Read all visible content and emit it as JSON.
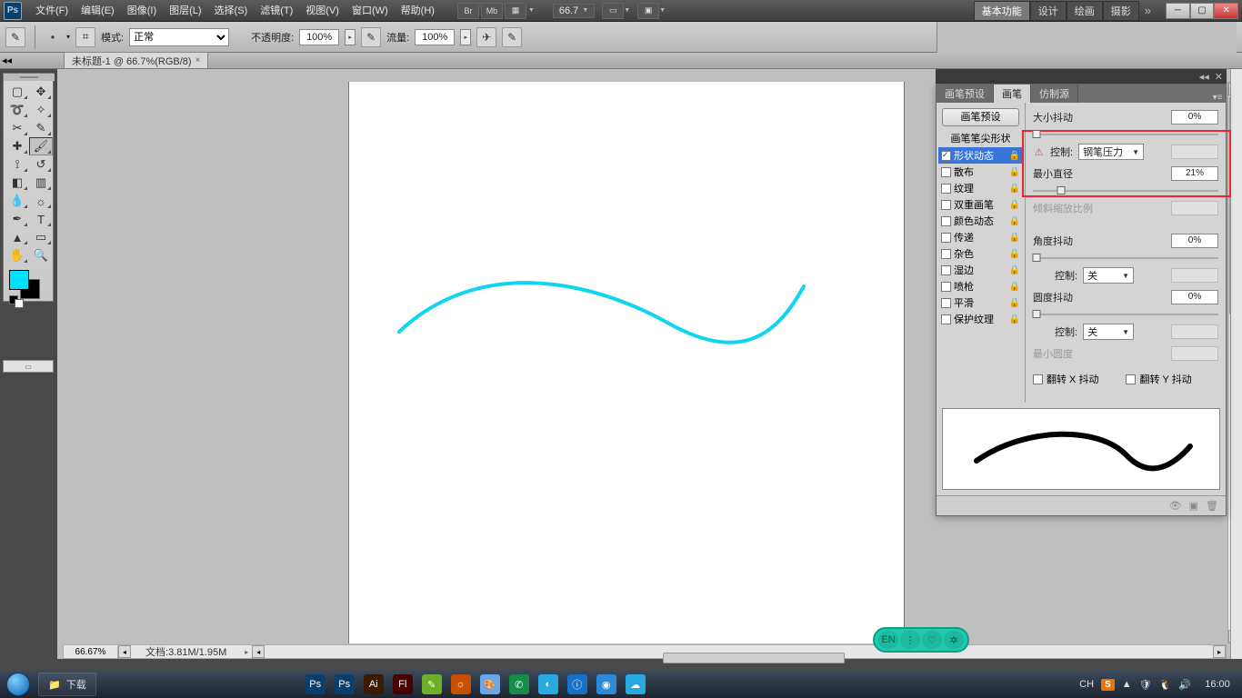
{
  "app": {
    "logo": "Ps"
  },
  "menu": [
    "文件(F)",
    "编辑(E)",
    "图像(I)",
    "图层(L)",
    "选择(S)",
    "滤镜(T)",
    "视图(V)",
    "窗口(W)",
    "帮助(H)"
  ],
  "menubar_icons": [
    "Br",
    "Mb",
    "▦"
  ],
  "menubar_zoom": "66.7",
  "workspaces": {
    "items": [
      "基本功能",
      "设计",
      "绘画",
      "摄影"
    ],
    "active": 0
  },
  "optbar": {
    "mode_label": "模式:",
    "mode_value": "正常",
    "opacity_label": "不透明度:",
    "opacity_value": "100%",
    "flow_label": "流量:",
    "flow_value": "100%"
  },
  "document_tab": {
    "title": "未标题-1 @ 66.7%(RGB/8)",
    "dirty": "×"
  },
  "status": {
    "zoom": "66.67%",
    "docinfo_label": "文档:",
    "docinfo": "3.81M/1.95M"
  },
  "tools": [
    "marquee",
    "move",
    "lasso",
    "wand",
    "crop",
    "eyedropper",
    "heal",
    "brush",
    "stamp",
    "history-brush",
    "eraser",
    "gradient",
    "blur",
    "dodge",
    "pen",
    "type",
    "path-select",
    "arrow",
    "hand",
    "zoom"
  ],
  "tools_selected": "brush",
  "panel": {
    "tabs": [
      "画笔预设",
      "画笔",
      "仿制源"
    ],
    "active_tab": 1,
    "preset_btn": "画笔预设",
    "tip_shape": "画笔笔尖形状",
    "options": [
      {
        "key": "shape",
        "label": "形状动态",
        "checked": true,
        "selected": true
      },
      {
        "key": "scatter",
        "label": "散布",
        "checked": false
      },
      {
        "key": "texture",
        "label": "纹理",
        "checked": false
      },
      {
        "key": "dual",
        "label": "双重画笔",
        "checked": false
      },
      {
        "key": "color",
        "label": "颜色动态",
        "checked": false
      },
      {
        "key": "transfer",
        "label": "传递",
        "checked": false
      },
      {
        "key": "noise",
        "label": "杂色",
        "checked": false
      },
      {
        "key": "wet",
        "label": "湿边",
        "checked": false
      },
      {
        "key": "airbrush",
        "label": "喷枪",
        "checked": false
      },
      {
        "key": "smooth",
        "label": "平滑",
        "checked": false
      },
      {
        "key": "protect",
        "label": "保护纹理",
        "checked": false
      }
    ],
    "right": {
      "size_jitter_label": "大小抖动",
      "size_jitter": "0%",
      "control_label": "控制:",
      "size_control": "钢笔压力",
      "min_diam_label": "最小直径",
      "min_diam": "21%",
      "min_diam_slider": 0.15,
      "tilt_label": "倾斜缩放比例",
      "angle_jitter_label": "角度抖动",
      "angle_jitter": "0%",
      "angle_control": "关",
      "round_jitter_label": "圆度抖动",
      "round_jitter": "0%",
      "round_control": "关",
      "min_round_label": "最小圆度",
      "flip_x": "翻转 X 抖动",
      "flip_y": "翻转 Y 抖动"
    }
  },
  "fab": [
    "EN",
    "⋮",
    "♡",
    "✲"
  ],
  "taskbar": {
    "pinned_label": "下载",
    "apps": [
      {
        "bg": "#0b3e6b",
        "txt": "Ps"
      },
      {
        "bg": "#0b3e6b",
        "txt": "Ps"
      },
      {
        "bg": "#3a1a00",
        "txt": "Ai"
      },
      {
        "bg": "#4a0000",
        "txt": "Fl"
      },
      {
        "bg": "#6fae2a",
        "txt": "✎"
      },
      {
        "bg": "#c94f00",
        "txt": "☼"
      },
      {
        "bg": "#6aa7e8",
        "txt": "🎨"
      },
      {
        "bg": "#178c4a",
        "txt": "✆"
      },
      {
        "bg": "#2aa9e0",
        "txt": "◐"
      },
      {
        "bg": "#1770c7",
        "txt": "ⓘ"
      },
      {
        "bg": "#2c89d8",
        "txt": "◉"
      },
      {
        "bg": "#2aa9e0",
        "txt": "☁"
      }
    ],
    "tray": [
      "CH",
      "▲",
      "♥",
      "🔊",
      "✴"
    ],
    "clock": "16:00"
  }
}
